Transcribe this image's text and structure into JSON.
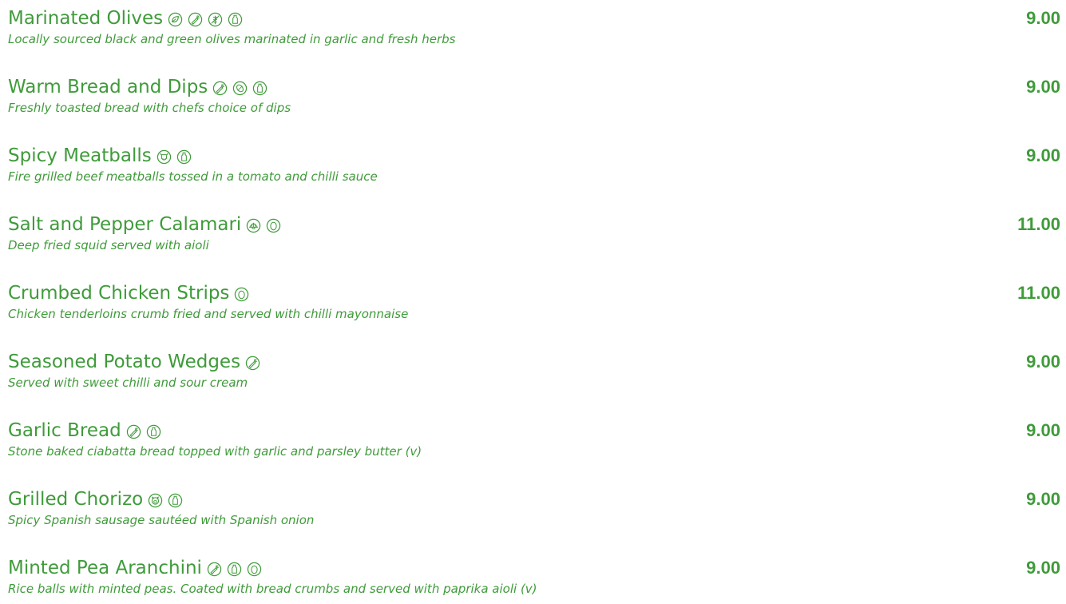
{
  "menu": {
    "items": [
      {
        "name": "Marinated Olives",
        "icons": [
          "leaf-icon",
          "carrot-icon",
          "wheat-icon",
          "milk-bottle-icon"
        ],
        "description": "Locally sourced black and green olives marinated in garlic and fresh herbs",
        "price": "9.00"
      },
      {
        "name": "Warm Bread and Dips",
        "icons": [
          "carrot-icon",
          "nut-icon",
          "milk-bottle-icon"
        ],
        "description": "Freshly toasted bread with chefs choice of dips",
        "price": "9.00"
      },
      {
        "name": "Spicy Meatballs",
        "icons": [
          "beef-icon",
          "milk-bottle-icon"
        ],
        "description": "Fire grilled beef meatballs tossed in a tomato and chilli sauce",
        "price": "9.00"
      },
      {
        "name": "Salt and Pepper Calamari",
        "icons": [
          "shellfish-icon",
          "egg-icon"
        ],
        "description": "Deep fried squid served with aioli",
        "price": "11.00"
      },
      {
        "name": "Crumbed Chicken Strips",
        "icons": [
          "egg-icon"
        ],
        "description": "Chicken tenderloins crumb fried and served with chilli mayonnaise",
        "price": "11.00"
      },
      {
        "name": "Seasoned Potato Wedges",
        "icons": [
          "carrot-icon"
        ],
        "description": "Served with sweet chilli and sour cream",
        "price": "9.00"
      },
      {
        "name": "Garlic Bread",
        "icons": [
          "carrot-icon",
          "milk-bottle-icon"
        ],
        "description": "Stone baked ciabatta bread topped with garlic and parsley butter (v)",
        "price": "9.00"
      },
      {
        "name": "Grilled Chorizo",
        "icons": [
          "pork-icon",
          "milk-bottle-icon"
        ],
        "description": "Spicy Spanish sausage sautéed with Spanish onion",
        "price": "9.00"
      },
      {
        "name": "Minted Pea Aranchini",
        "icons": [
          "carrot-icon",
          "milk-bottle-icon",
          "egg-icon"
        ],
        "description": "Rice balls with minted peas. Coated with bread crumbs and served with paprika aioli (v)",
        "price": "9.00"
      }
    ]
  },
  "colors": {
    "text": "#3f9b3a",
    "background": "#ffffff"
  }
}
